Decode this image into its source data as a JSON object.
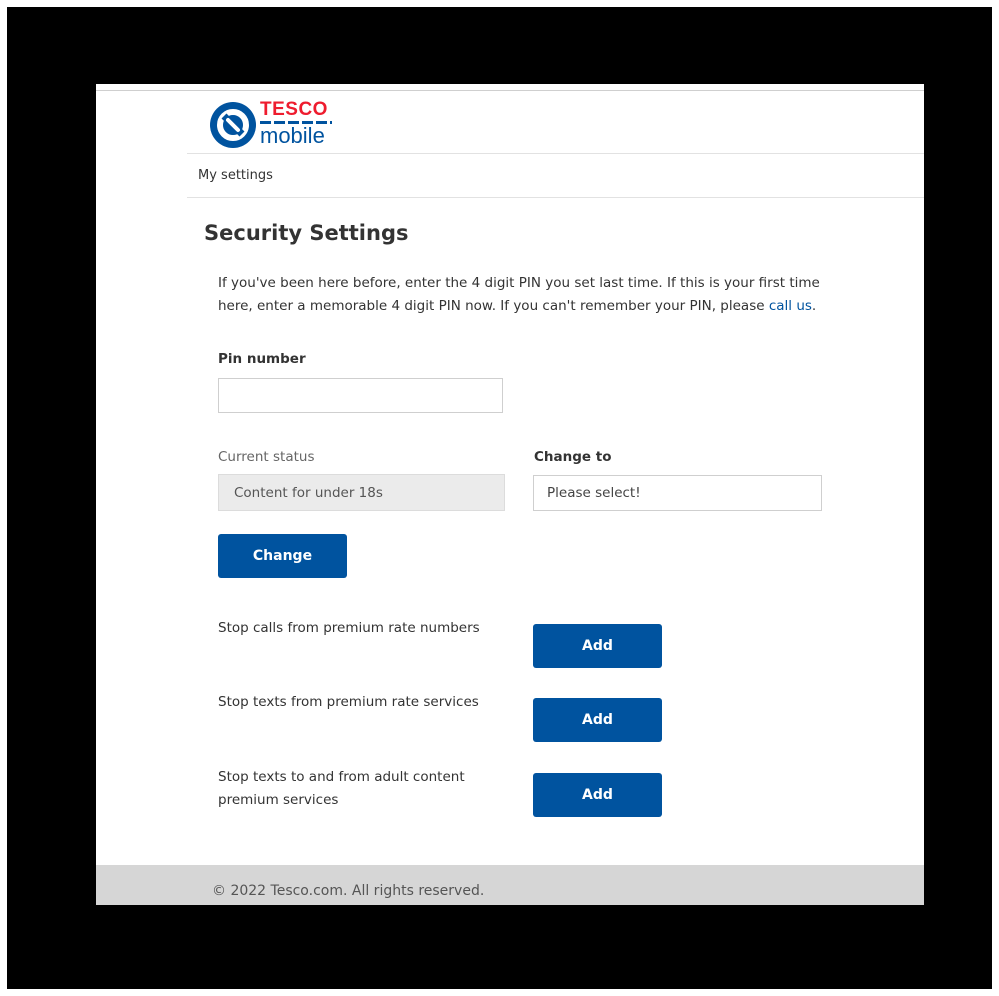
{
  "brand": {
    "name_top": "TESCO",
    "name_bottom": "mobile",
    "primary_color": "#00539f",
    "accent_color": "#ee1c2e"
  },
  "nav": {
    "my_settings": "My settings"
  },
  "page": {
    "title": "Security Settings",
    "intro_text": "If you've been here before, enter the 4 digit PIN you set last time. If this is your first time here, enter a memorable 4 digit PIN now. If you can't remember your PIN, please ",
    "intro_link": "call us",
    "intro_end": "."
  },
  "pin": {
    "label": "Pin number",
    "value": ""
  },
  "status": {
    "current_label": "Current status",
    "current_value": "Content for under 18s",
    "change_to_label": "Change to",
    "change_to_value": "Please select!",
    "change_button": "Change"
  },
  "options": [
    {
      "label": "Stop calls from premium rate numbers",
      "button": "Add"
    },
    {
      "label": "Stop texts from premium rate services",
      "button": "Add"
    },
    {
      "label": "Stop texts to and from adult content premium services",
      "button": "Add"
    }
  ],
  "footer": {
    "copyright": "© 2022 Tesco.com. All rights reserved."
  }
}
